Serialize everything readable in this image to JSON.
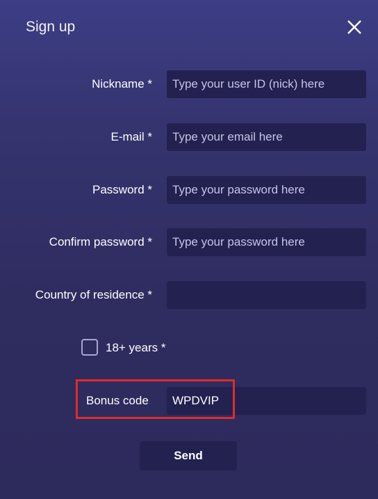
{
  "dialog": {
    "title": "Sign up",
    "close_icon": "close-icon"
  },
  "form": {
    "fields": [
      {
        "label": "Nickname *",
        "placeholder": "Type your user ID (nick) here",
        "value": ""
      },
      {
        "label": "E-mail *",
        "placeholder": "Type your email here",
        "value": ""
      },
      {
        "label": "Password *",
        "placeholder": "Type your password here",
        "value": ""
      },
      {
        "label": "Confirm password *",
        "placeholder": "Type your password here",
        "value": ""
      },
      {
        "label": "Country of residence *",
        "placeholder": "",
        "value": ""
      }
    ],
    "age_checkbox": {
      "label": "18+ years *",
      "checked": false
    },
    "bonus": {
      "label": "Bonus code",
      "value": "WPDVIP"
    },
    "send_label": "Send"
  },
  "colors": {
    "background": "#35346f",
    "input_bg": "#232150",
    "highlight": "#e22a2a"
  }
}
